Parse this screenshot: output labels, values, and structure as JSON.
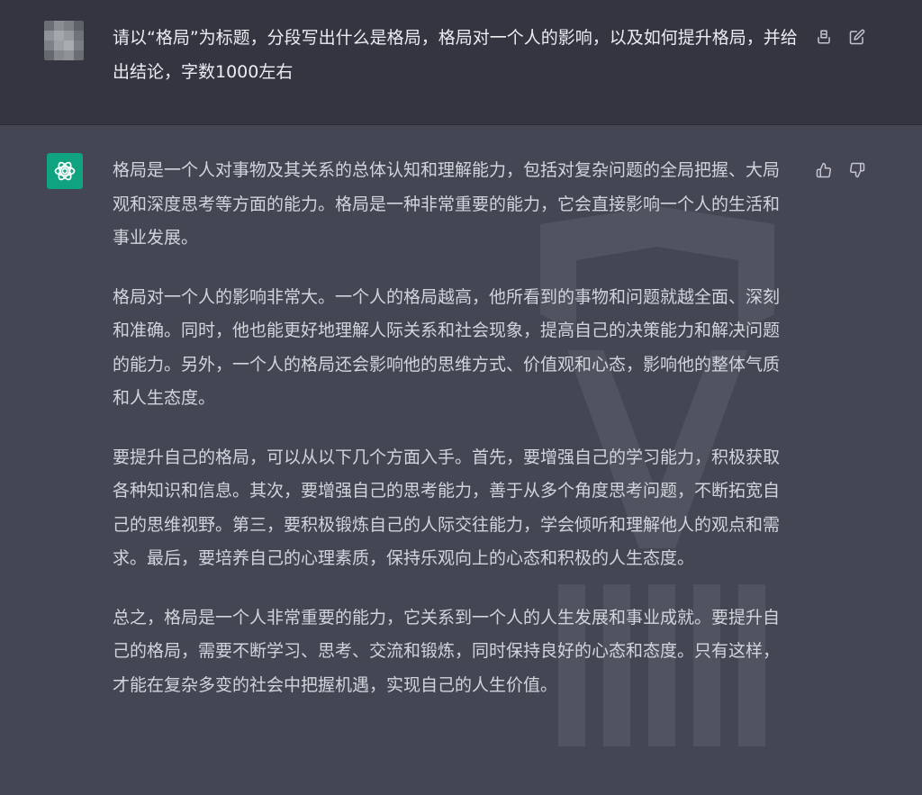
{
  "user_message": {
    "avatar": "pixelated-user-avatar",
    "text": "请以“格局”为标题，分段写出什么是格局，格局对一个人的影响，以及如何提升格局，并给出结论，字数1000左右",
    "actions": [
      {
        "icon": "copy-icon"
      },
      {
        "icon": "edit-icon"
      }
    ]
  },
  "assistant_message": {
    "avatar": "chatgpt-logo-icon",
    "paragraphs": [
      "格局是一个人对事物及其关系的总体认知和理解能力，包括对复杂问题的全局把握、大局观和深度思考等方面的能力。格局是一种非常重要的能力，它会直接影响一个人的生活和事业发展。",
      "格局对一个人的影响非常大。一个人的格局越高，他所看到的事物和问题就越全面、深刻和准确。同时，他也能更好地理解人际关系和社会现象，提高自己的决策能力和解决问题的能力。另外，一个人的格局还会影响他的思维方式、价值观和心态，影响他的整体气质和人生态度。",
      "要提升自己的格局，可以从以下几个方面入手。首先，要增强自己的学习能力，积极获取各种知识和信息。其次，要增强自己的思考能力，善于从多个角度思考问题，不断拓宽自己的思维视野。第三，要积极锻炼自己的人际交往能力，学会倾听和理解他人的观点和需求。最后，要培养自己的心理素质，保持乐观向上的心态和积极的人生态度。",
      "总之，格局是一个人非常重要的能力，它关系到一个人的人生发展和事业成就。要提升自己的格局，需要不断学习、思考、交流和锻炼，同时保持良好的心态和态度。只有这样，才能在复杂多变的社会中把握机遇，实现自己的人生价值。"
    ],
    "actions": [
      {
        "icon": "thumbs-up-icon"
      },
      {
        "icon": "thumbs-down-icon"
      }
    ]
  },
  "colors": {
    "user_bg": "#343541",
    "assistant_bg": "#444654",
    "text_primary": "#ececf1",
    "text_secondary": "#d1d5db",
    "icon": "#c5c5d2",
    "brand_green": "#10a37f"
  }
}
